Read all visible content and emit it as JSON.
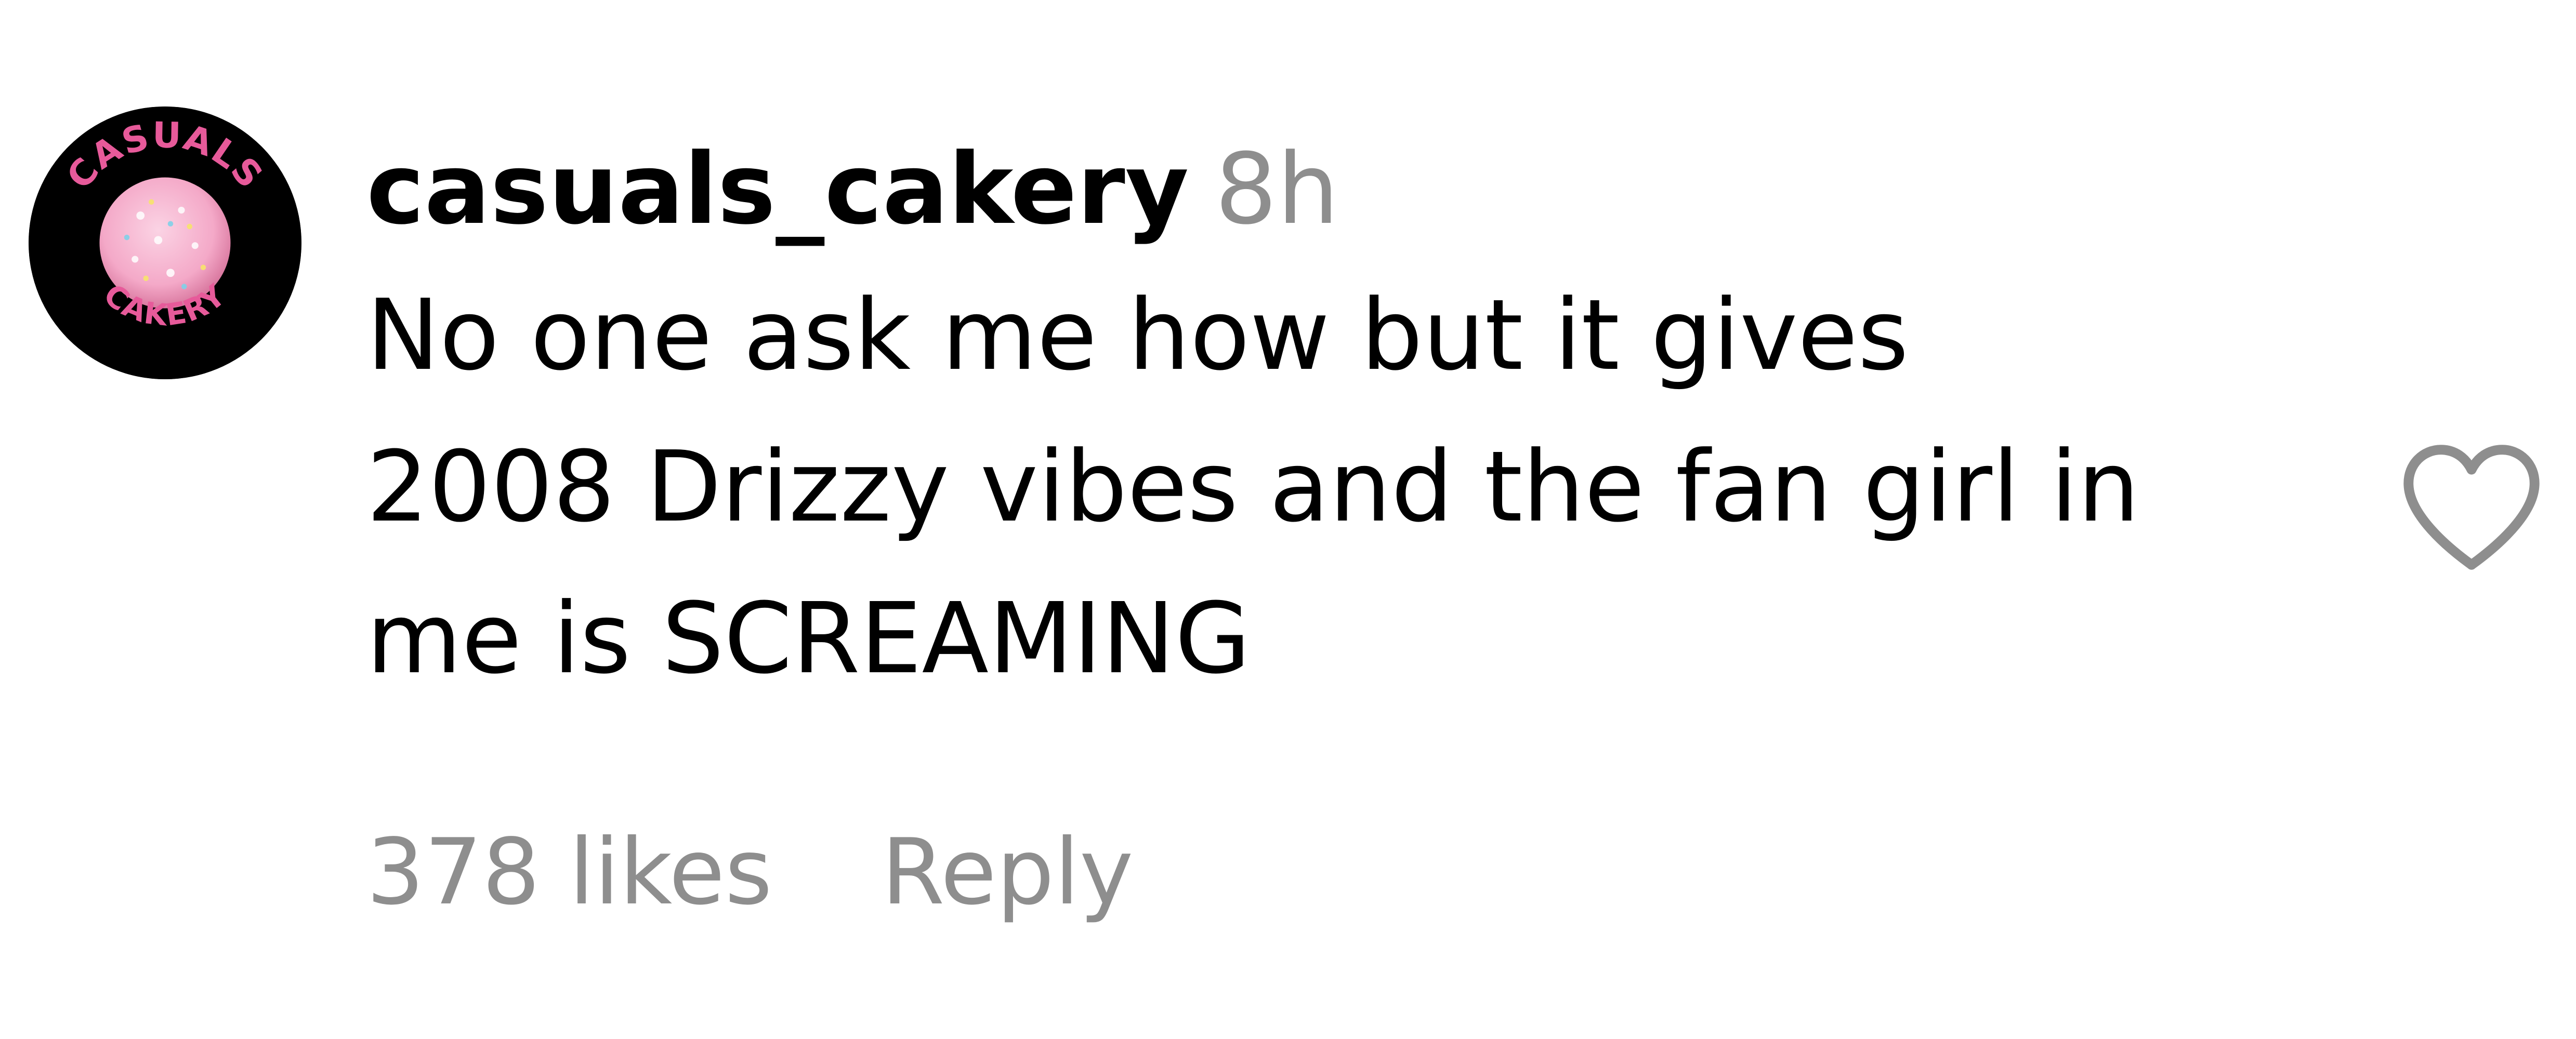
{
  "comment": {
    "avatar": {
      "icon": "casuals-cakery-logo-icon",
      "logo_text_top": "CASUALS",
      "logo_text_bottom": "CAKERY",
      "colors": {
        "ring": "#000000",
        "lettering": "#e75a9a",
        "cake": "#f4a9c8"
      }
    },
    "username": "casuals_cakery",
    "timestamp": "8h",
    "text_lines": [
      "No one ask me how but it gives",
      "2008 Drizzy vibes and the fan girl in",
      "me is SCREAMING"
    ],
    "likes_label": "378 likes",
    "reply_label": "Reply",
    "like_icon": "heart-outline-icon",
    "colors": {
      "primary_text": "#000000",
      "secondary_text": "#8e8e8e",
      "heart_stroke": "#8e8e8e"
    }
  }
}
